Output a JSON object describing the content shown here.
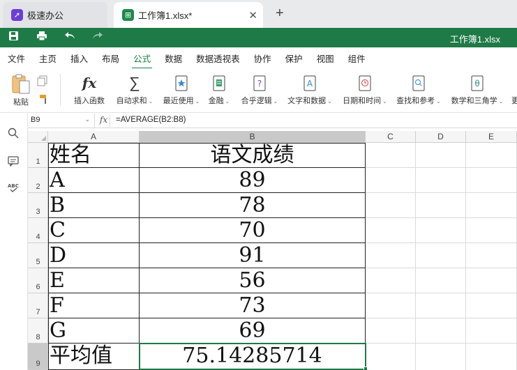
{
  "tabs": [
    {
      "label": "极速办公",
      "icon": "rocket-icon"
    },
    {
      "label": "工作簿1.xlsx*",
      "icon": "spreadsheet-icon"
    }
  ],
  "titlebar": {
    "doc_title": "工作簿1.xlsx"
  },
  "menu": [
    "文件",
    "主页",
    "插入",
    "布局",
    "公式",
    "数据",
    "数据透视表",
    "协作",
    "保护",
    "视图",
    "组件"
  ],
  "menu_active": "公式",
  "ribbon": {
    "paste": "粘贴",
    "insert_function": "插入函数",
    "autosum": "自动求和",
    "recent": "最近使用",
    "finance": "金融",
    "logic": "合乎逻辑",
    "text_data": "文字和数据",
    "datetime": "日期和时间",
    "lookup": "查找和参考",
    "math": "数学和三角学",
    "more": "更"
  },
  "formula_bar": {
    "cell_ref": "B9",
    "formula": "=AVERAGE(B2:B8)"
  },
  "columns": [
    "A",
    "B",
    "C",
    "D",
    "E"
  ],
  "rows": [
    "1",
    "2",
    "3",
    "4",
    "5",
    "6",
    "7",
    "8",
    "9"
  ],
  "sheet": {
    "header": [
      "姓名",
      "语文成绩"
    ],
    "data": [
      [
        "A",
        "89"
      ],
      [
        "B",
        "78"
      ],
      [
        "C",
        "70"
      ],
      [
        "D",
        "91"
      ],
      [
        "E",
        "56"
      ],
      [
        "F",
        "73"
      ],
      [
        "G",
        "69"
      ]
    ],
    "footer": [
      "平均值",
      "75.14285714"
    ]
  },
  "colors": {
    "accent": "#1e7a46",
    "tab_bg": "#e9eaec"
  }
}
